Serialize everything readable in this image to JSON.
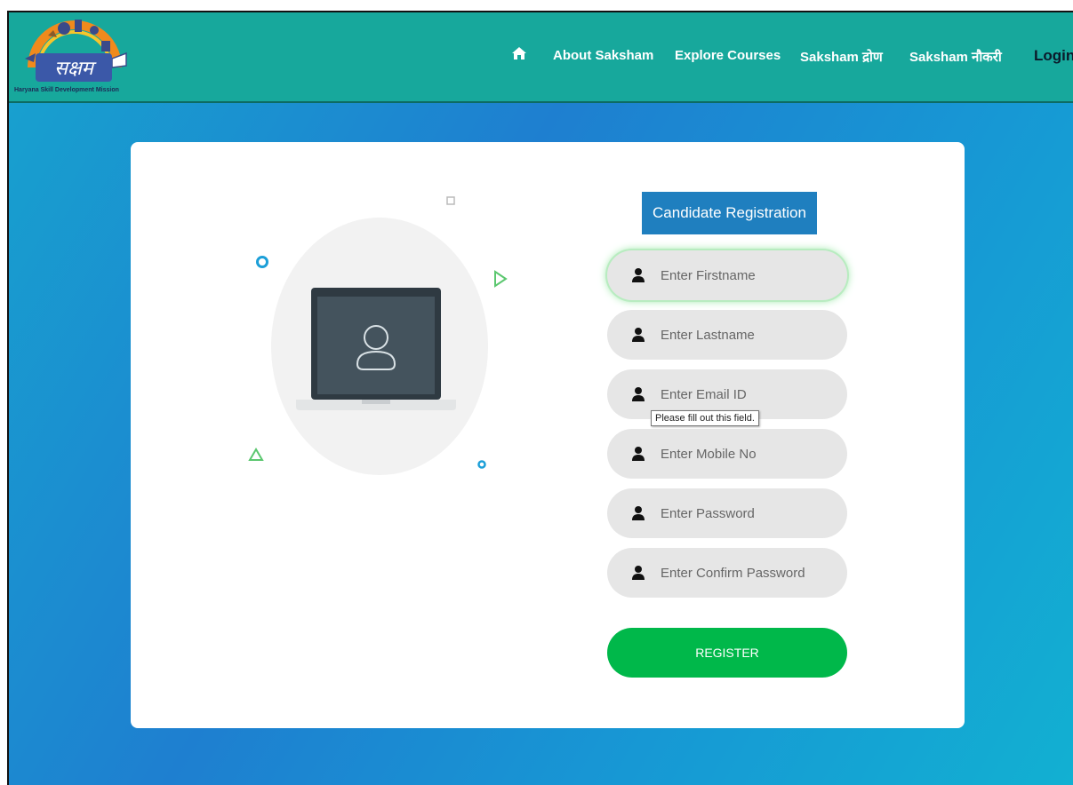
{
  "header": {
    "logo_text": "सक्षम",
    "logo_subtitle": "Haryana Skill Development Mission",
    "nav": {
      "home_icon": "home-icon",
      "about": "About Saksham",
      "courses": "Explore Courses",
      "drona": "Saksham द्रोण",
      "naukri": "Saksham नौकरी",
      "login": "Login"
    }
  },
  "form": {
    "title": "Candidate Registration",
    "fields": [
      {
        "placeholder": "Enter Firstname",
        "value": "",
        "icon": "user-icon"
      },
      {
        "placeholder": "Enter Lastname",
        "value": "",
        "icon": "user-icon"
      },
      {
        "placeholder": "Enter Email ID",
        "value": "",
        "icon": "user-icon"
      },
      {
        "placeholder": "Enter Mobile No",
        "value": "",
        "icon": "user-icon"
      },
      {
        "placeholder": "Enter Password",
        "value": "",
        "icon": "user-icon"
      },
      {
        "placeholder": "Enter Confirm Password",
        "value": "",
        "icon": "user-icon"
      }
    ],
    "validation_tooltip": "Please fill out this field.",
    "submit_label": "REGISTER"
  },
  "colors": {
    "navbar": "#17a89c",
    "title_bg": "#1f7fbf",
    "button": "#00b84a",
    "field_bg": "#e6e6e6"
  }
}
